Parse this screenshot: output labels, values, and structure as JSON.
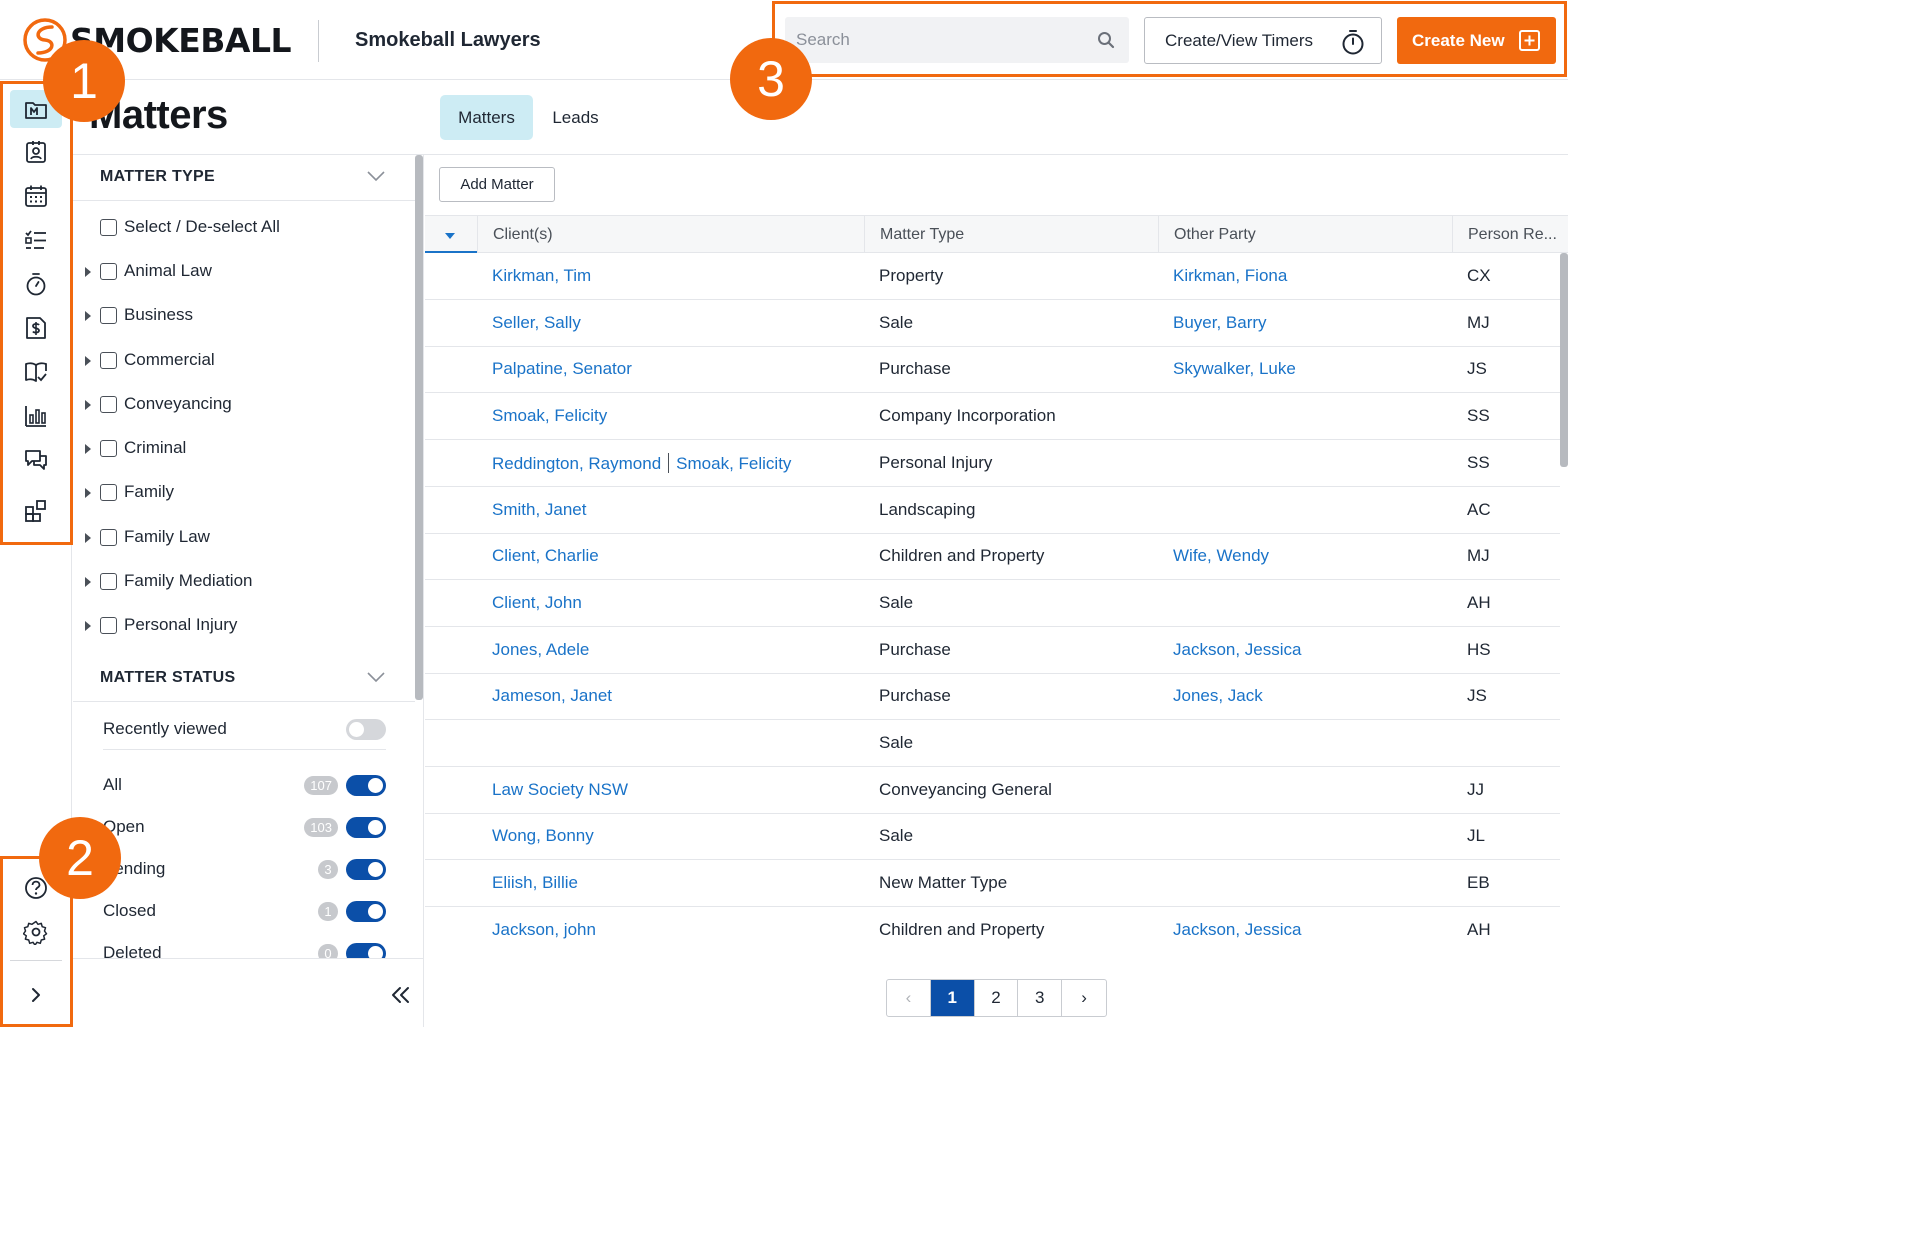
{
  "header": {
    "logo_text": "SMOKEBALL",
    "firm_name": "Smokeball Lawyers",
    "search_placeholder": "Search",
    "timers_label": "Create/View Timers",
    "create_new_label": "Create New"
  },
  "rail": {
    "top_icons": [
      "matters-icon",
      "contacts-icon",
      "calendar-icon",
      "tasks-icon",
      "timer-icon",
      "billing-icon",
      "library-icon",
      "reports-icon",
      "communicate-icon",
      "apps-icon"
    ],
    "bottom_icons": [
      "help-icon",
      "settings-icon",
      "expand-icon"
    ]
  },
  "page": {
    "title": "Matters",
    "tabs": [
      {
        "label": "Matters",
        "active": true
      },
      {
        "label": "Leads",
        "active": false
      }
    ]
  },
  "filters": {
    "matter_type": {
      "heading": "MATTER TYPE",
      "select_all": "Select / De-select All",
      "items": [
        "Animal Law",
        "Business",
        "Commercial",
        "Conveyancing",
        "Criminal",
        "Family",
        "Family Law",
        "Family Mediation",
        "Personal Injury"
      ]
    },
    "matter_status": {
      "heading": "MATTER STATUS",
      "recently_viewed": {
        "label": "Recently viewed",
        "on": false
      },
      "statuses": [
        {
          "label": "All",
          "count": "107",
          "on": true
        },
        {
          "label": "Open",
          "count": "103",
          "on": true
        },
        {
          "label": "Pending",
          "count": "3",
          "on": true
        },
        {
          "label": "Closed",
          "count": "1",
          "on": true
        },
        {
          "label": "Deleted",
          "count": "0",
          "on": true
        }
      ]
    }
  },
  "table": {
    "add_button": "Add Matter",
    "columns": [
      "Client(s)",
      "Matter Type",
      "Other Party",
      "Person Re..."
    ],
    "rows": [
      {
        "clients": [
          "Kirkman, Tim"
        ],
        "type": "Property",
        "other": "Kirkman, Fiona",
        "person": "CX"
      },
      {
        "clients": [
          "Seller, Sally"
        ],
        "type": "Sale",
        "other": "Buyer, Barry",
        "person": "MJ"
      },
      {
        "clients": [
          "Palpatine, Senator"
        ],
        "type": "Purchase",
        "other": "Skywalker, Luke",
        "person": "JS"
      },
      {
        "clients": [
          "Smoak, Felicity"
        ],
        "type": "Company Incorporation",
        "other": "",
        "person": "SS"
      },
      {
        "clients": [
          "Reddington, Raymond",
          "Smoak, Felicity"
        ],
        "type": "Personal Injury",
        "other": "",
        "person": "SS"
      },
      {
        "clients": [
          "Smith, Janet"
        ],
        "type": "Landscaping",
        "other": "",
        "person": "AC"
      },
      {
        "clients": [
          "Client, Charlie"
        ],
        "type": "Children and Property",
        "other": "Wife, Wendy",
        "person": "MJ"
      },
      {
        "clients": [
          "Client, John"
        ],
        "type": "Sale",
        "other": "",
        "person": "AH"
      },
      {
        "clients": [
          "Jones, Adele"
        ],
        "type": "Purchase",
        "other": "Jackson, Jessica",
        "person": "HS"
      },
      {
        "clients": [
          "Jameson, Janet"
        ],
        "type": "Purchase",
        "other": "Jones, Jack",
        "person": "JS"
      },
      {
        "clients": [],
        "type": "Sale",
        "other": "",
        "person": ""
      },
      {
        "clients": [
          "Law Society NSW"
        ],
        "type": "Conveyancing General",
        "other": "",
        "person": "JJ"
      },
      {
        "clients": [
          "Wong, Bonny"
        ],
        "type": "Sale",
        "other": "",
        "person": "JL"
      },
      {
        "clients": [
          "Eliish, Billie"
        ],
        "type": "New Matter Type",
        "other": "",
        "person": "EB"
      },
      {
        "clients": [
          "Jackson, john"
        ],
        "type": "Children and Property",
        "other": "Jackson, Jessica",
        "person": "AH"
      }
    ]
  },
  "pagination": {
    "prev": "‹",
    "pages": [
      "1",
      "2",
      "3"
    ],
    "current": "1",
    "next": "›"
  },
  "callouts": [
    "1",
    "2",
    "3"
  ],
  "colors": {
    "accent": "#f1690f",
    "link": "#1a73c8",
    "toggle_on": "#0b4fa8",
    "active_tab": "#cdecf4"
  }
}
